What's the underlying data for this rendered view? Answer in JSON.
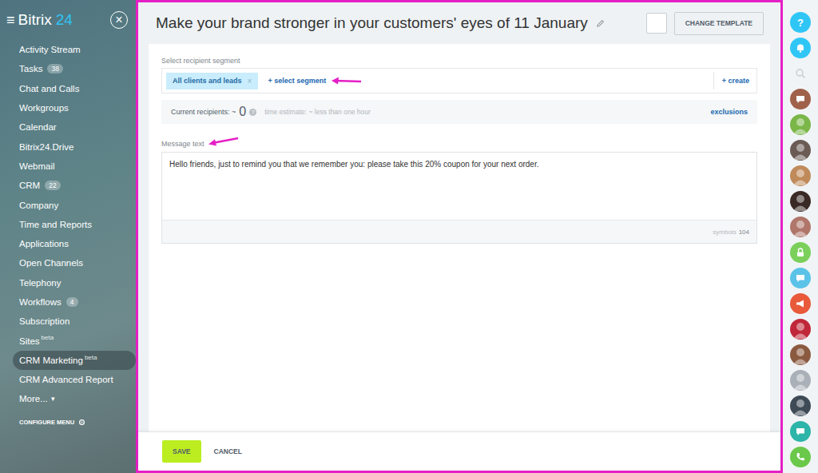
{
  "sidebar": {
    "menu_icon": "≡",
    "logo": "Bitrix",
    "logo_number": "24",
    "close": "×",
    "items": [
      {
        "label": "Activity Stream",
        "counter": "",
        "badge": "",
        "arrow": "",
        "selected": false
      },
      {
        "label": "Tasks",
        "counter": "38",
        "badge": "",
        "arrow": "",
        "selected": false
      },
      {
        "label": "Chat and Calls",
        "counter": "",
        "badge": "",
        "arrow": "",
        "selected": false
      },
      {
        "label": "Workgroups",
        "counter": "",
        "badge": "",
        "arrow": "",
        "selected": false
      },
      {
        "label": "Calendar",
        "counter": "",
        "badge": "",
        "arrow": "",
        "selected": false
      },
      {
        "label": "Bitrix24.Drive",
        "counter": "",
        "badge": "",
        "arrow": "",
        "selected": false
      },
      {
        "label": "Webmail",
        "counter": "",
        "badge": "",
        "arrow": "",
        "selected": false
      },
      {
        "label": "CRM",
        "counter": "22",
        "badge": "",
        "arrow": "",
        "selected": false
      },
      {
        "label": "Company",
        "counter": "",
        "badge": "",
        "arrow": "",
        "selected": false
      },
      {
        "label": "Time and Reports",
        "counter": "",
        "badge": "",
        "arrow": "",
        "selected": false
      },
      {
        "label": "Applications",
        "counter": "",
        "badge": "",
        "arrow": "",
        "selected": false
      },
      {
        "label": "Open Channels",
        "counter": "",
        "badge": "",
        "arrow": "",
        "selected": false
      },
      {
        "label": "Telephony",
        "counter": "",
        "badge": "",
        "arrow": "",
        "selected": false
      },
      {
        "label": "Workflows",
        "counter": "4",
        "badge": "",
        "arrow": "",
        "selected": false
      },
      {
        "label": "Subscription",
        "counter": "",
        "badge": "",
        "arrow": "",
        "selected": false
      },
      {
        "label": "Sites",
        "counter": "",
        "badge": "beta",
        "arrow": "",
        "selected": false
      },
      {
        "label": "CRM Marketing",
        "counter": "",
        "badge": "beta",
        "arrow": "",
        "selected": true
      },
      {
        "label": "CRM Advanced Report",
        "counter": "",
        "badge": "",
        "arrow": "",
        "selected": false
      },
      {
        "label": "More...",
        "counter": "",
        "badge": "",
        "arrow": "▾",
        "selected": false
      }
    ],
    "configure": "CONFIGURE MENU"
  },
  "editor": {
    "title": "Make your brand stronger in your customers' eyes of 11 January",
    "change_template": "CHANGE TEMPLATE",
    "segment_label": "Select recipient segment",
    "segments": [
      {
        "label": "All clients and leads",
        "remove": "×"
      }
    ],
    "select_segment": "+ select segment",
    "create": "+ create",
    "recipients_label": "Current recipients: ~",
    "recipients_count": "0",
    "help": "?",
    "time_estimate": "time estimate: ~ less than one hour",
    "exclusions": "exclusions",
    "message_label": "Message text",
    "message": "Hello friends, just to remind you that we remember you: please take this 20% coupon for your next order.",
    "symbols_label": "symbols",
    "symbols_count": "104"
  },
  "footer": {
    "save": "SAVE",
    "cancel": "CANCEL"
  },
  "rightbar": [
    {
      "kind": "help",
      "label": "?",
      "color": "#2fc6f6"
    },
    {
      "kind": "bell",
      "label": "",
      "color": "#2fc6f6"
    },
    {
      "kind": "search",
      "label": "",
      "color": "#c4cbd0"
    },
    {
      "kind": "chat",
      "label": "",
      "color": "#a0614a"
    },
    {
      "kind": "group",
      "label": "",
      "color": "#7ab648"
    },
    {
      "kind": "avatar",
      "label": "",
      "color": "#6b5b55"
    },
    {
      "kind": "avatar",
      "label": "",
      "color": "#c08a5a"
    },
    {
      "kind": "avatar",
      "label": "",
      "color": "#3a2a26"
    },
    {
      "kind": "avatar",
      "label": "",
      "color": "#b0766a"
    },
    {
      "kind": "lock",
      "label": "",
      "color": "#7ad05a"
    },
    {
      "kind": "chat",
      "label": "",
      "color": "#5bc3e8"
    },
    {
      "kind": "megaphone",
      "label": "",
      "color": "#e85a3a"
    },
    {
      "kind": "avatar",
      "label": "",
      "color": "#c0283a"
    },
    {
      "kind": "avatar",
      "label": "",
      "color": "#8a5a40"
    },
    {
      "kind": "avatar",
      "label": "",
      "color": "#aab0b8"
    },
    {
      "kind": "avatar",
      "label": "",
      "color": "#3e4a56"
    },
    {
      "kind": "chat",
      "label": "",
      "color": "#2cb5a8"
    },
    {
      "kind": "phone",
      "label": "",
      "color": "#6ac84a"
    }
  ]
}
